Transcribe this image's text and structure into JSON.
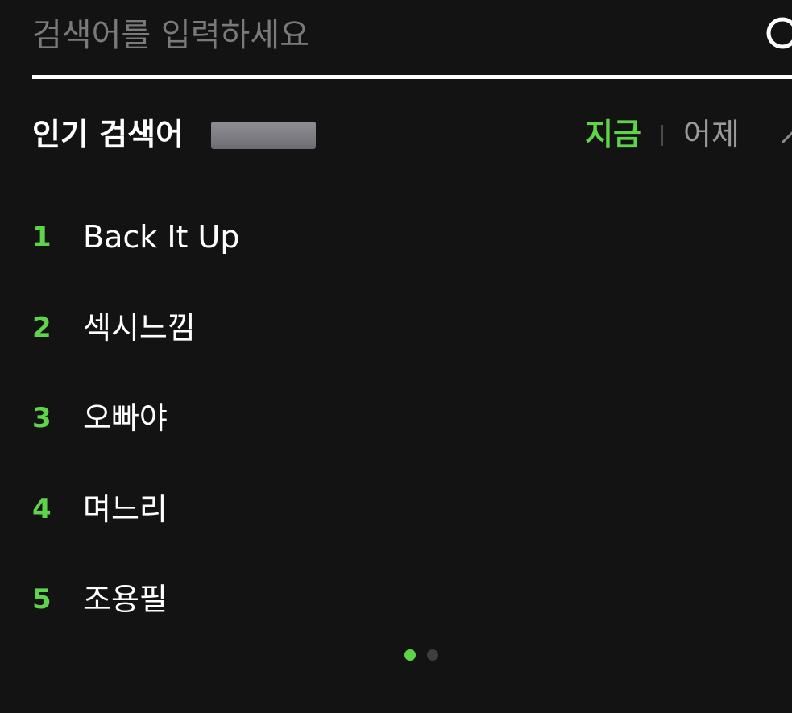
{
  "search": {
    "placeholder": "검색어를 입력하세요",
    "value": ""
  },
  "popular": {
    "title": "인기 검색어",
    "tabs": [
      {
        "label": "지금",
        "selected": true
      },
      {
        "label": "어제",
        "selected": false
      }
    ],
    "items": [
      {
        "rank": "1",
        "keyword": "Back It Up"
      },
      {
        "rank": "2",
        "keyword": "섹시느낌"
      },
      {
        "rank": "3",
        "keyword": "오빠야"
      },
      {
        "rank": "4",
        "keyword": "며느리"
      },
      {
        "rank": "5",
        "keyword": "조용필"
      }
    ],
    "pager": {
      "pages": 2,
      "current": 1
    }
  },
  "colors": {
    "background": "#131313",
    "accent": "#5fd44a",
    "text": "#ffffff",
    "muted": "#9a9a9a"
  },
  "icons": {
    "search": "search-icon",
    "more": "chevron-up-icon"
  }
}
